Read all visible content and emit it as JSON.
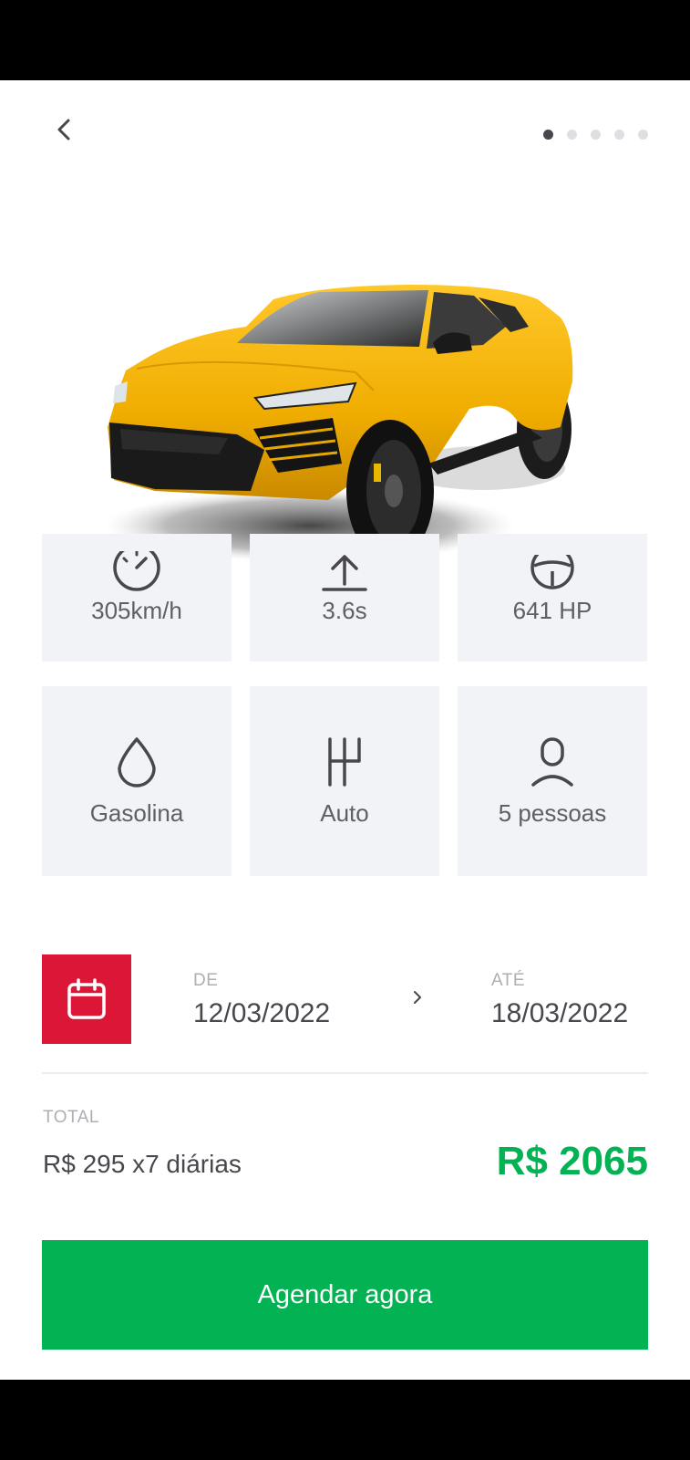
{
  "carousel": {
    "count": 5,
    "active": 1
  },
  "specs": [
    {
      "icon": "speedometer-icon",
      "label": "305km/h"
    },
    {
      "icon": "acceleration-icon",
      "label": "3.6s"
    },
    {
      "icon": "steering-wheel-icon",
      "label": "641 HP"
    },
    {
      "icon": "drop-icon",
      "label": "Gasolina"
    },
    {
      "icon": "gear-shift-icon",
      "label": "Auto"
    },
    {
      "icon": "person-icon",
      "label": "5 pessoas"
    }
  ],
  "rental": {
    "from_label": "DE",
    "from_date": "12/03/2022",
    "to_label": "ATÉ",
    "to_date": "18/03/2022"
  },
  "total": {
    "label": "TOTAL",
    "description": "R$ 295 x7 diárias",
    "price": "R$ 2065"
  },
  "cta_label": "Agendar agora",
  "colors": {
    "accent_red": "#DC1637",
    "success_green": "#03B252",
    "card_bg": "#F2F3F6",
    "text": "#47474D"
  }
}
